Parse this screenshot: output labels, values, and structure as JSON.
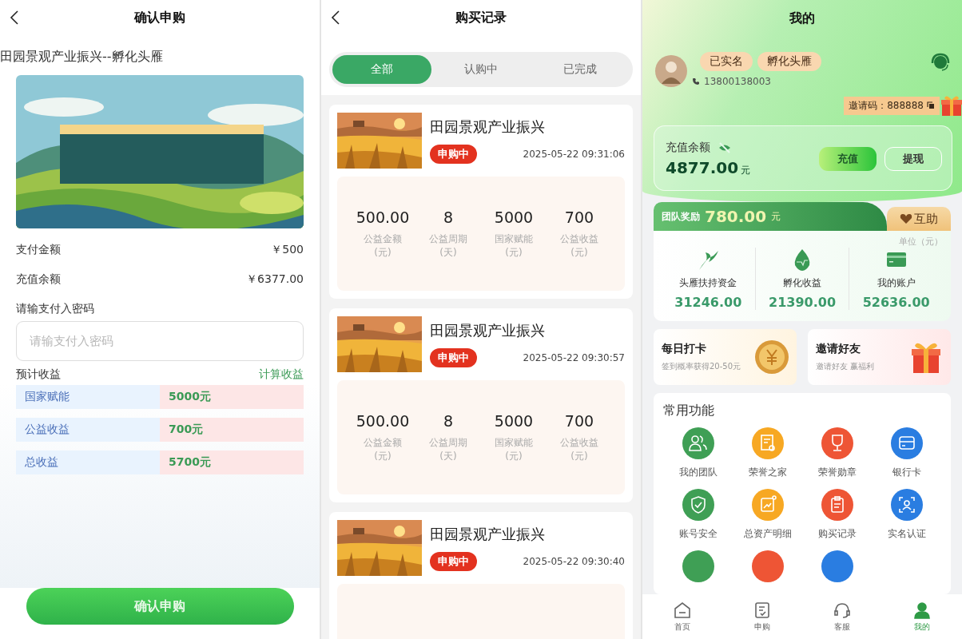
{
  "confirm_screen": {
    "title": "确认申购",
    "product": "田园景观产业振兴--孵化头雁",
    "details": [
      {
        "label": "支付金额",
        "value": "￥500"
      },
      {
        "label": "充值余额",
        "value": "￥6377.00"
      }
    ],
    "password_label": "请输支付入密码",
    "password_field": {
      "placeholder": "请输支付入密码"
    },
    "estimate_label": "预计收益",
    "calc_link": "计算收益",
    "returns": [
      {
        "label": "国家赋能",
        "value": "5000元"
      },
      {
        "label": "公益收益",
        "value": "700元"
      },
      {
        "label": "总收益",
        "value": "5700元"
      }
    ],
    "confirm_button": "确认申购"
  },
  "records_screen": {
    "title": "购买记录",
    "tabs": [
      {
        "label": "全部",
        "selected": true
      },
      {
        "label": "认购中",
        "selected": false
      },
      {
        "label": "已完成",
        "selected": false
      }
    ],
    "records": [
      {
        "name": "田园景观产业振兴",
        "status": "申购中",
        "time": "2025-05-22 09:31:06",
        "stats": [
          {
            "value": "500.00",
            "label": "公益金额(元)"
          },
          {
            "value": "8",
            "label": "公益周期(天)"
          },
          {
            "value": "5000",
            "label": "国家赋能(元)"
          },
          {
            "value": "700",
            "label": "公益收益(元)"
          }
        ]
      },
      {
        "name": "田园景观产业振兴",
        "status": "申购中",
        "time": "2025-05-22 09:30:57",
        "stats": [
          {
            "value": "500.00",
            "label": "公益金额(元)"
          },
          {
            "value": "8",
            "label": "公益周期(天)"
          },
          {
            "value": "5000",
            "label": "国家赋能(元)"
          },
          {
            "value": "700",
            "label": "公益收益(元)"
          }
        ]
      },
      {
        "name": "田园景观产业振兴",
        "status": "申购中",
        "time": "2025-05-22 09:30:40"
      }
    ]
  },
  "profile_screen": {
    "title": "我的",
    "badges": [
      "已实名",
      "孵化头雁"
    ],
    "phone": "13800138003",
    "invite_code": "邀请码：888888",
    "balance": {
      "label": "充值余额",
      "amount": "4877.00",
      "unit": "元"
    },
    "buttons": [
      {
        "label": "充值",
        "primary": true
      },
      {
        "label": "提现",
        "primary": false
      }
    ],
    "team_reward": {
      "label": "团队奖励",
      "amount": "780.00",
      "unit": "元"
    },
    "mutual_aid": "互助",
    "unit_note": "单位（元）",
    "funds": [
      {
        "kind": "swallow",
        "label": "头雁扶持资金",
        "value": "31246.00"
      },
      {
        "kind": "egg",
        "label": "孵化收益",
        "value": "21390.00"
      },
      {
        "kind": "card",
        "label": "我的账户",
        "value": "52636.00"
      }
    ],
    "promos": [
      {
        "kind": "coin",
        "title": "每日打卡",
        "subtitle": "签到概率获得20-50元"
      },
      {
        "kind": "gift",
        "title": "邀请好友",
        "subtitle": "邀请好友 赢福利"
      }
    ],
    "functions_title": "常用功能",
    "functions": [
      {
        "kind": "team",
        "label": "我的团队",
        "color": "#3f9f55"
      },
      {
        "kind": "certificate",
        "label": "荣誉之家",
        "color": "#f7a823"
      },
      {
        "kind": "trophy",
        "label": "荣誉勋章",
        "color": "#ee5535"
      },
      {
        "kind": "bankcard",
        "label": "银行卡",
        "color": "#2a7de1"
      },
      {
        "kind": "shield",
        "label": "账号安全",
        "color": "#3f9f55"
      },
      {
        "kind": "chart",
        "label": "总资产明细",
        "color": "#f7a823"
      },
      {
        "kind": "clipboard",
        "label": "购买记录",
        "color": "#ee5535"
      },
      {
        "kind": "face",
        "label": "实名认证",
        "color": "#2a7de1"
      },
      {
        "kind": "blank",
        "color": "#3f9f55"
      },
      {
        "kind": "blank",
        "color": "#ee5535"
      },
      {
        "kind": "blank",
        "color": "#2a7de1"
      }
    ],
    "tab_bar": [
      {
        "kind": "home",
        "label": "首页",
        "selected": false
      },
      {
        "kind": "form",
        "label": "申购",
        "selected": false
      },
      {
        "kind": "headset",
        "label": "客服",
        "selected": false
      },
      {
        "kind": "person",
        "label": "我的",
        "selected": true
      }
    ]
  }
}
